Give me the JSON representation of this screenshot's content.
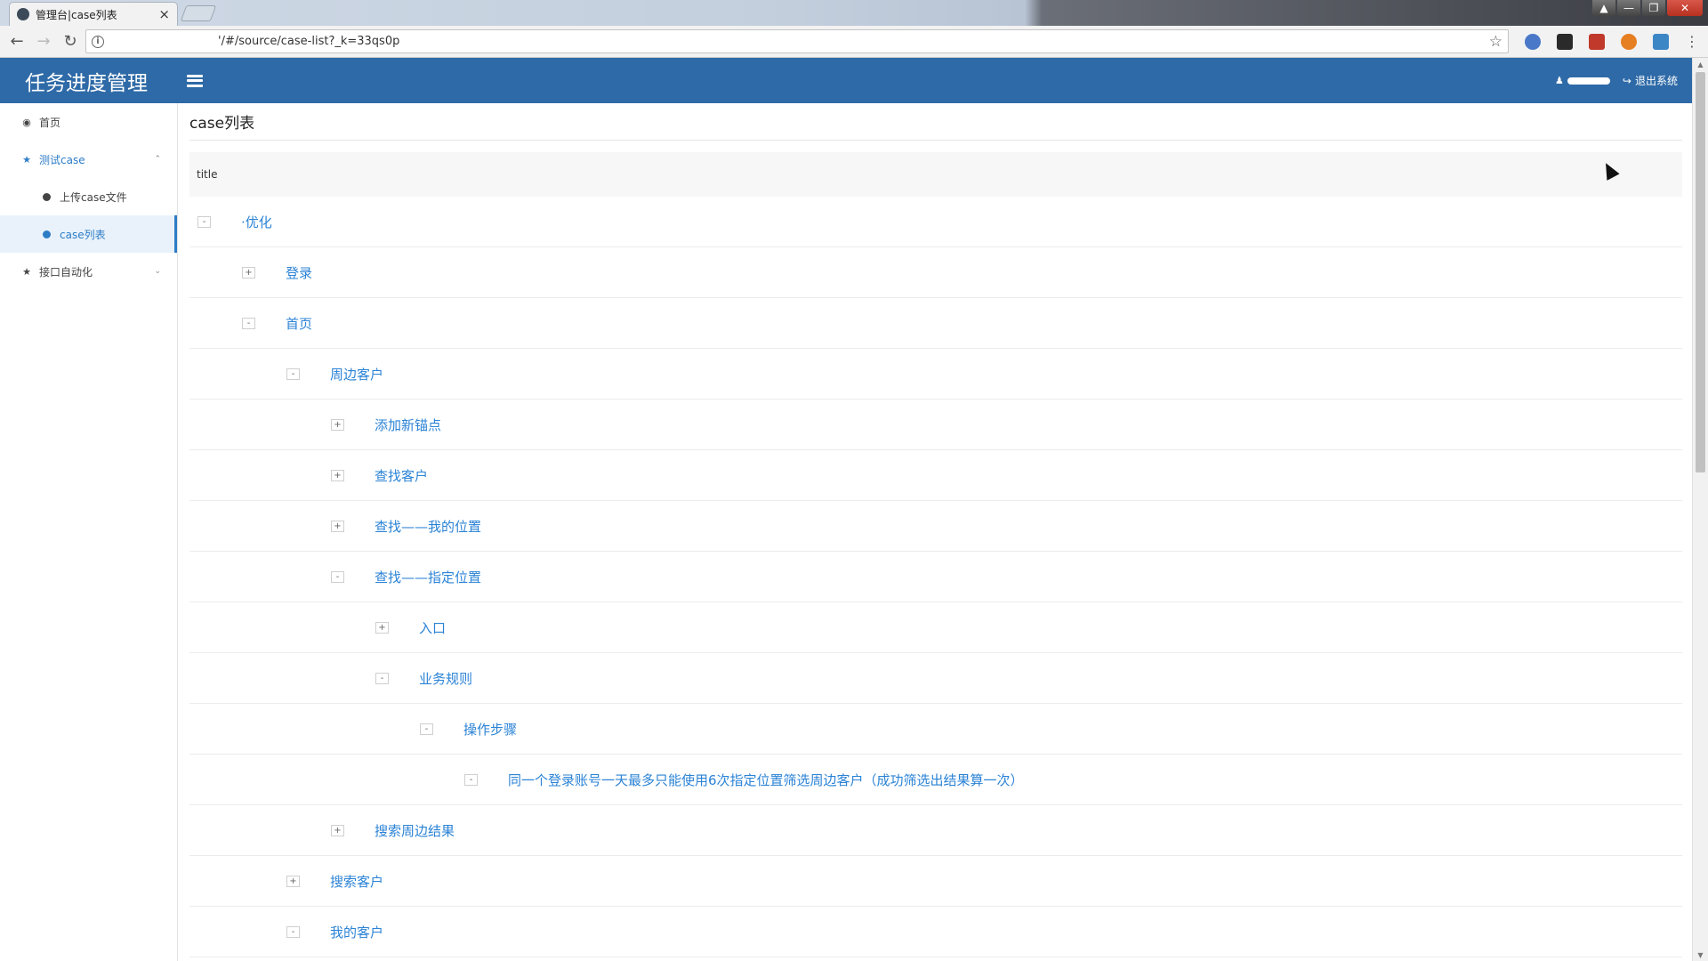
{
  "browser": {
    "tab_title": "管理台|case列表",
    "tab_close": "×",
    "url": "'/#/source/case-list?_k=33qs0p",
    "window_controls": [
      "▲",
      "—",
      "❐",
      "✕"
    ]
  },
  "header": {
    "brand": "任务进度管理",
    "logout": "退出系统"
  },
  "sidebar": {
    "items": [
      {
        "label": "首页",
        "icon": "dashboard-icon"
      },
      {
        "label": "测试case",
        "icon": "star-icon",
        "expanded": true
      },
      {
        "label": "上传case文件",
        "icon": "dot-icon"
      },
      {
        "label": "case列表",
        "icon": "dot-icon",
        "active": true
      },
      {
        "label": "接口自动化",
        "icon": "star-icon",
        "expanded": false
      }
    ]
  },
  "main": {
    "page_title": "case列表",
    "column_header": "title",
    "rows": [
      {
        "label": "·优化",
        "toggle": "-",
        "level": 0
      },
      {
        "label": "登录",
        "toggle": "+",
        "level": 1
      },
      {
        "label": "首页",
        "toggle": "-",
        "level": 1
      },
      {
        "label": "周边客户",
        "toggle": "-",
        "level": 2
      },
      {
        "label": "添加新锚点",
        "toggle": "+",
        "level": 3
      },
      {
        "label": "查找客户",
        "toggle": "+",
        "level": 3
      },
      {
        "label": "查找——我的位置",
        "toggle": "+",
        "level": 3
      },
      {
        "label": "查找——指定位置",
        "toggle": "-",
        "level": 3
      },
      {
        "label": "入口",
        "toggle": "+",
        "level": 4
      },
      {
        "label": "业务规则",
        "toggle": "-",
        "level": 4
      },
      {
        "label": "操作步骤",
        "toggle": "-",
        "level": 5
      },
      {
        "label": "同一个登录账号一天最多只能使用6次指定位置筛选周边客户（成功筛选出结果算一次）",
        "toggle": "-",
        "level": 6
      },
      {
        "label": "搜索周边结果",
        "toggle": "+",
        "level": 3
      },
      {
        "label": "搜索客户",
        "toggle": "+",
        "level": 2
      },
      {
        "label": "我的客户",
        "toggle": "-",
        "level": 2
      }
    ]
  },
  "colors": {
    "header_bg": "#2e6aa7",
    "link": "#2b83d6",
    "active_bg": "#e9f2fb"
  }
}
